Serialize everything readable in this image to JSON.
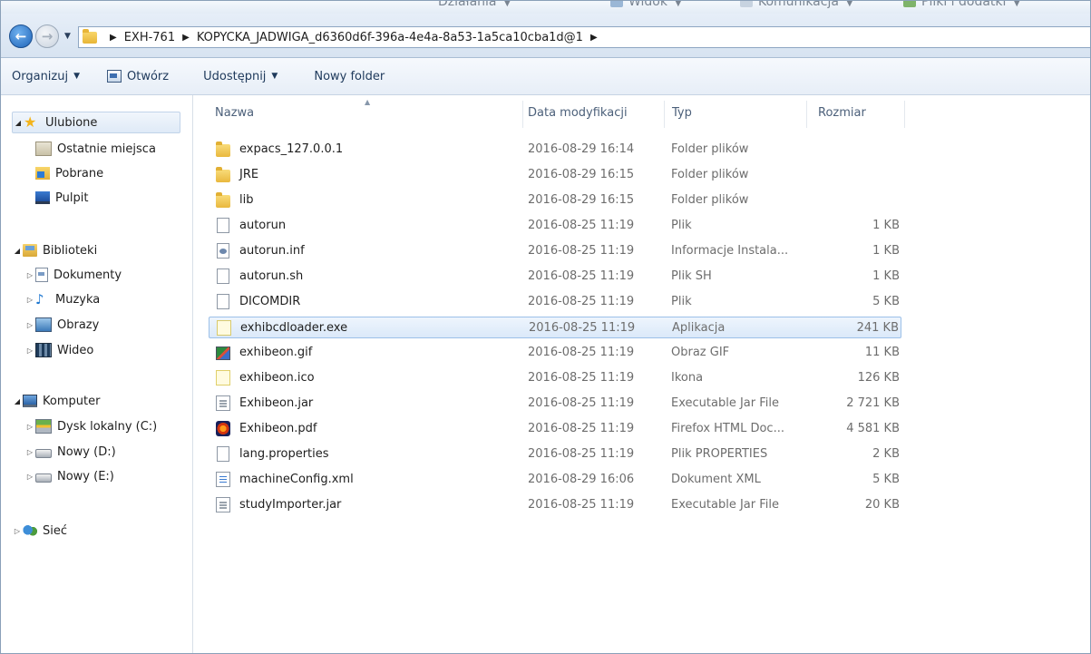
{
  "ghost_bar": {
    "items": [
      {
        "label": "Działania",
        "left": 0
      },
      {
        "label": "Widok"
      },
      {
        "label": "Komunikacja"
      },
      {
        "label": "Pliki i dodatki"
      }
    ]
  },
  "address": {
    "breadcrumbs": [
      "EXH-761",
      "KOPYCKA_JADWIGA_d6360d6f-396a-4e4a-8a53-1a5ca10cba1d@1"
    ]
  },
  "toolbar": {
    "organize": "Organizuj",
    "open": "Otwórz",
    "share": "Udostępnij",
    "new_folder": "Nowy folder"
  },
  "nav": {
    "favorites": "Ulubione",
    "recent": "Ostatnie miejsca",
    "downloads": "Pobrane",
    "desktop": "Pulpit",
    "libraries": "Biblioteki",
    "documents": "Dokumenty",
    "music": "Muzyka",
    "pictures": "Obrazy",
    "video": "Wideo",
    "computer": "Komputer",
    "drive_c": "Dysk lokalny (C:)",
    "drive_d": "Nowy (D:)",
    "drive_e": "Nowy (E:)",
    "network": "Sieć"
  },
  "columns": {
    "name": "Nazwa",
    "date": "Data modyfikacji",
    "type": "Typ",
    "size": "Rozmiar"
  },
  "files": [
    {
      "name": "expacs_127.0.0.1",
      "date": "2016-08-29 16:14",
      "type": "Folder plików",
      "size": "",
      "icon": "folder-icon"
    },
    {
      "name": "JRE",
      "date": "2016-08-29 16:15",
      "type": "Folder plików",
      "size": "",
      "icon": "folder-icon"
    },
    {
      "name": "lib",
      "date": "2016-08-29 16:15",
      "type": "Folder plików",
      "size": "",
      "icon": "folder-icon"
    },
    {
      "name": "autorun",
      "date": "2016-08-25 11:19",
      "type": "Plik",
      "size": "1 KB",
      "icon": "blank-file-icon"
    },
    {
      "name": "autorun.inf",
      "date": "2016-08-25 11:19",
      "type": "Informacje Instala...",
      "size": "1 KB",
      "icon": "setup-info-file-icon"
    },
    {
      "name": "autorun.sh",
      "date": "2016-08-25 11:19",
      "type": "Plik SH",
      "size": "1 KB",
      "icon": "blank-file-icon"
    },
    {
      "name": "DICOMDIR",
      "date": "2016-08-25 11:19",
      "type": "Plik",
      "size": "5 KB",
      "icon": "blank-file-icon"
    },
    {
      "name": "exhibcdloader.exe",
      "date": "2016-08-25 11:19",
      "type": "Aplikacja",
      "size": "241 KB",
      "icon": "application-icon",
      "selected": true
    },
    {
      "name": "exhibeon.gif",
      "date": "2016-08-25 11:19",
      "type": "Obraz GIF",
      "size": "11 KB",
      "icon": "gif-image-icon"
    },
    {
      "name": "exhibeon.ico",
      "date": "2016-08-25 11:19",
      "type": "Ikona",
      "size": "126 KB",
      "icon": "ico-file-icon"
    },
    {
      "name": "Exhibeon.jar",
      "date": "2016-08-25 11:19",
      "type": "Executable Jar File",
      "size": "2 721 KB",
      "icon": "jar-file-icon"
    },
    {
      "name": "Exhibeon.pdf",
      "date": "2016-08-25 11:19",
      "type": "Firefox HTML Doc...",
      "size": "4 581 KB",
      "icon": "firefox-pdf-icon"
    },
    {
      "name": "lang.properties",
      "date": "2016-08-25 11:19",
      "type": "Plik PROPERTIES",
      "size": "2 KB",
      "icon": "blank-file-icon"
    },
    {
      "name": "machineConfig.xml",
      "date": "2016-08-29 16:06",
      "type": "Dokument XML",
      "size": "5 KB",
      "icon": "xml-file-icon"
    },
    {
      "name": "studyImporter.jar",
      "date": "2016-08-25 11:19",
      "type": "Executable Jar File",
      "size": "20 KB",
      "icon": "jar-file-icon"
    }
  ],
  "colors": {
    "selection_border": "#9cc0e8",
    "selection_fill": "#dbe9f9",
    "header_text": "#4c607a",
    "folder_yellow": "#e9b83e"
  }
}
